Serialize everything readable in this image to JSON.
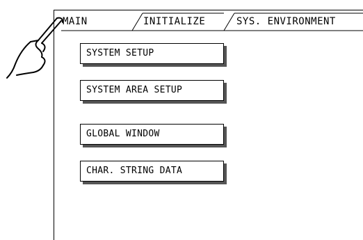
{
  "tabs": [
    {
      "label": "MAIN"
    },
    {
      "label": "INITIALIZE"
    },
    {
      "label": "SYS. ENVIRONMENT"
    }
  ],
  "menu": {
    "items": [
      {
        "label": "SYSTEM SETUP"
      },
      {
        "label": "SYSTEM AREA SETUP"
      },
      {
        "label": "GLOBAL WINDOW"
      },
      {
        "label": "CHAR. STRING DATA"
      }
    ]
  },
  "colors": {
    "background": "#ffffff",
    "line": "#000000",
    "button_shadow": "#555555"
  },
  "icons": {
    "pointer": "pointing-hand-icon"
  }
}
